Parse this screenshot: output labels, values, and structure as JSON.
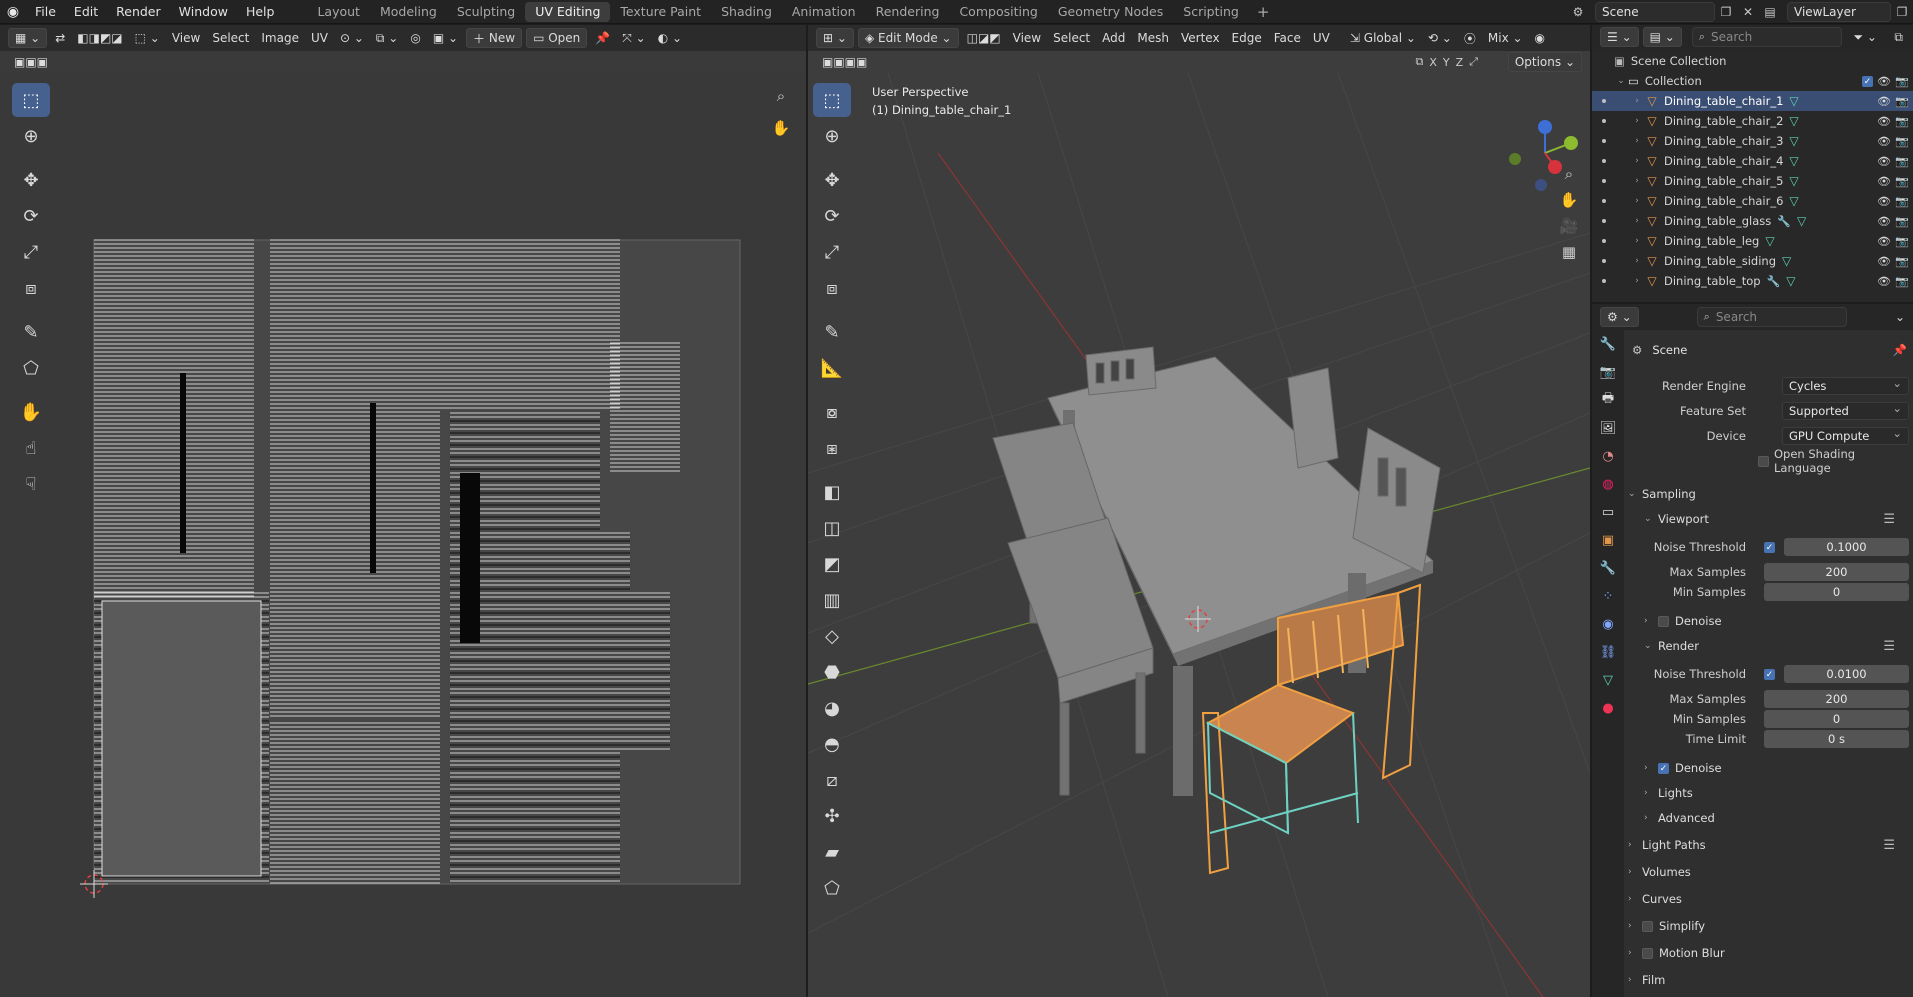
{
  "topbar": {
    "menus": [
      "File",
      "Edit",
      "Render",
      "Window",
      "Help"
    ],
    "workspaces": [
      "Layout",
      "Modeling",
      "Sculpting",
      "UV Editing",
      "Texture Paint",
      "Shading",
      "Animation",
      "Rendering",
      "Compositing",
      "Geometry Nodes",
      "Scripting"
    ],
    "active_workspace": "UV Editing",
    "scene": "Scene",
    "view_layer": "ViewLayer"
  },
  "uv_editor": {
    "menus": [
      "View",
      "Select",
      "Image",
      "UV"
    ],
    "new_label": "New",
    "open_label": "Open"
  },
  "viewport": {
    "mode": "Edit Mode",
    "menus": [
      "View",
      "Select",
      "Add",
      "Mesh",
      "Vertex",
      "Edge",
      "Face",
      "UV"
    ],
    "orientation": "Global",
    "shading": "Mix",
    "options_label": "Options",
    "axes": [
      "X",
      "Y",
      "Z"
    ],
    "overlay_line1": "User Perspective",
    "overlay_line2": "(1) Dining_table_chair_1"
  },
  "outliner": {
    "search_placeholder": "Search",
    "root": "Scene Collection",
    "collection": "Collection",
    "items": [
      {
        "name": "Dining_table_chair_1",
        "selected": true,
        "modifier": false
      },
      {
        "name": "Dining_table_chair_2",
        "selected": false,
        "modifier": false
      },
      {
        "name": "Dining_table_chair_3",
        "selected": false,
        "modifier": false
      },
      {
        "name": "Dining_table_chair_4",
        "selected": false,
        "modifier": false
      },
      {
        "name": "Dining_table_chair_5",
        "selected": false,
        "modifier": false
      },
      {
        "name": "Dining_table_chair_6",
        "selected": false,
        "modifier": false
      },
      {
        "name": "Dining_table_glass",
        "selected": false,
        "modifier": true
      },
      {
        "name": "Dining_table_leg",
        "selected": false,
        "modifier": false
      },
      {
        "name": "Dining_table_siding",
        "selected": false,
        "modifier": false
      },
      {
        "name": "Dining_table_top",
        "selected": false,
        "modifier": true
      }
    ]
  },
  "properties": {
    "search_placeholder": "Search",
    "context": "Scene",
    "render_engine_label": "Render Engine",
    "render_engine": "Cycles",
    "feature_set_label": "Feature Set",
    "feature_set": "Supported",
    "device_label": "Device",
    "device": "GPU Compute",
    "osl_label": "Open Shading Language",
    "sampling": "Sampling",
    "viewport_section": "Viewport",
    "viewport_noise_label": "Noise Threshold",
    "viewport_noise": "0.1000",
    "viewport_max_label": "Max Samples",
    "viewport_max": "200",
    "viewport_min_label": "Min Samples",
    "viewport_min": "0",
    "viewport_denoise": "Denoise",
    "render_section": "Render",
    "render_noise_label": "Noise Threshold",
    "render_noise": "0.0100",
    "render_max_label": "Max Samples",
    "render_max": "200",
    "render_min_label": "Min Samples",
    "render_min": "0",
    "time_limit_label": "Time Limit",
    "time_limit": "0 s",
    "render_denoise": "Denoise",
    "lights": "Lights",
    "advanced": "Advanced",
    "light_paths": "Light Paths",
    "volumes": "Volumes",
    "curves": "Curves",
    "simplify": "Simplify",
    "motion_blur": "Motion Blur",
    "film": "Film"
  },
  "colors": {
    "accent": "#4772b3",
    "selection": "#3a4e73",
    "object_icon": "#e3954c",
    "mesh_icon": "#5fd1b4",
    "edit_wire": "#f0a040"
  }
}
